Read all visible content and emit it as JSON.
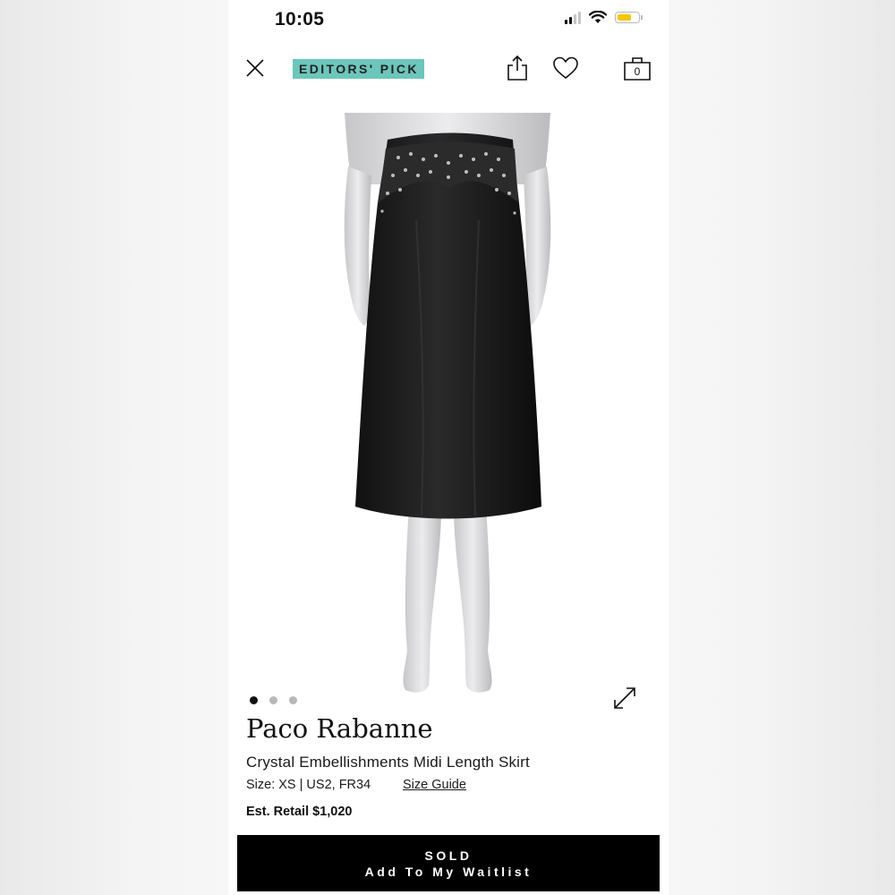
{
  "status_bar": {
    "time": "10:05",
    "icons": [
      "cellular-signal-icon",
      "wifi-icon",
      "battery-icon"
    ],
    "battery_color": "#f7c600"
  },
  "nav": {
    "badge": "EDITORS' PICK",
    "badge_color": "#6cc6bb",
    "icons": [
      "close-icon",
      "share-icon",
      "heart-icon",
      "shopping-bag-icon"
    ],
    "bag_count": "0"
  },
  "gallery": {
    "image_description_icon": "product-photo-skirt-on-mannequin",
    "pages": 3,
    "current_page": 1,
    "expand_icon": "expand-icon"
  },
  "product": {
    "brand": "Paco Rabanne",
    "name": "Crystal Embellishments Midi Length Skirt",
    "size": "Size: XS | US2, FR34",
    "size_guide": "Size Guide",
    "retail": "Est. Retail $1,020"
  },
  "cta": {
    "line1": "SOLD",
    "line2": "Add To My Waitlist"
  }
}
